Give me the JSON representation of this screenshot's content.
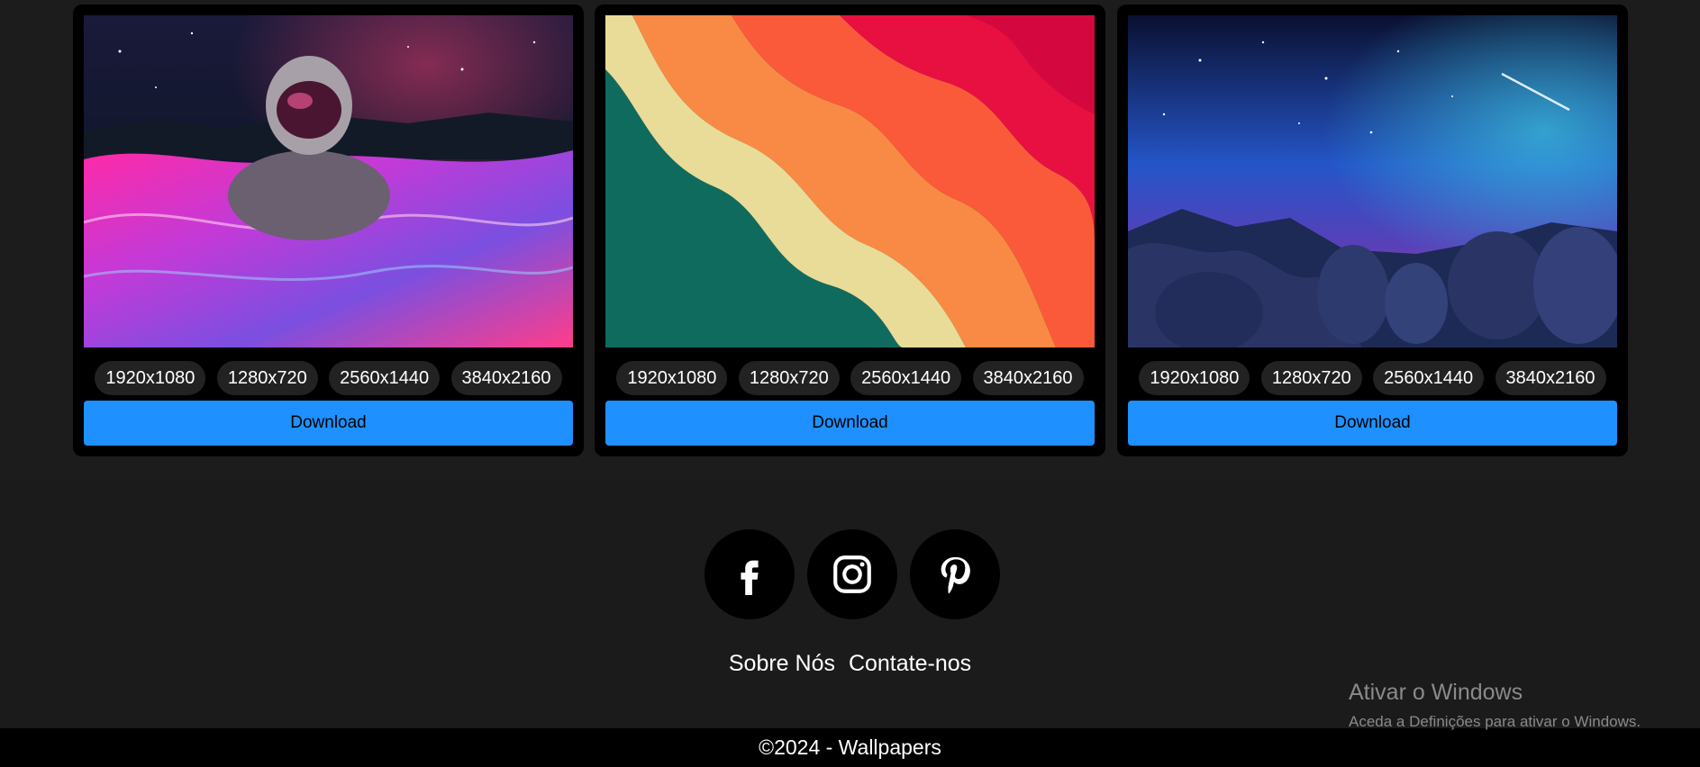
{
  "cards": [
    {
      "image_desc": "astronaut-galaxy-wallpaper",
      "resolutions": [
        "1920x1080",
        "1280x720",
        "2560x1440",
        "3840x2160"
      ],
      "download_label": "Download"
    },
    {
      "image_desc": "wavy-stripes-wallpaper",
      "resolutions": [
        "1920x1080",
        "1280x720",
        "2560x1440",
        "3840x2160"
      ],
      "download_label": "Download"
    },
    {
      "image_desc": "starry-night-rocks-wallpaper",
      "resolutions": [
        "1920x1080",
        "1280x720",
        "2560x1440",
        "3840x2160"
      ],
      "download_label": "Download"
    }
  ],
  "footer": {
    "social": [
      "facebook-icon",
      "instagram-icon",
      "pinterest-icon"
    ],
    "links": [
      "Sobre Nós",
      "Contate-nos"
    ],
    "copyright": "©2024 - Wallpapers"
  },
  "watermark": {
    "title": "Ativar o Windows",
    "subtitle": "Aceda a Definições para ativar o Windows."
  },
  "colors": {
    "accent": "#1e90ff",
    "card": "#000000",
    "bg": "#1b1b1b"
  }
}
